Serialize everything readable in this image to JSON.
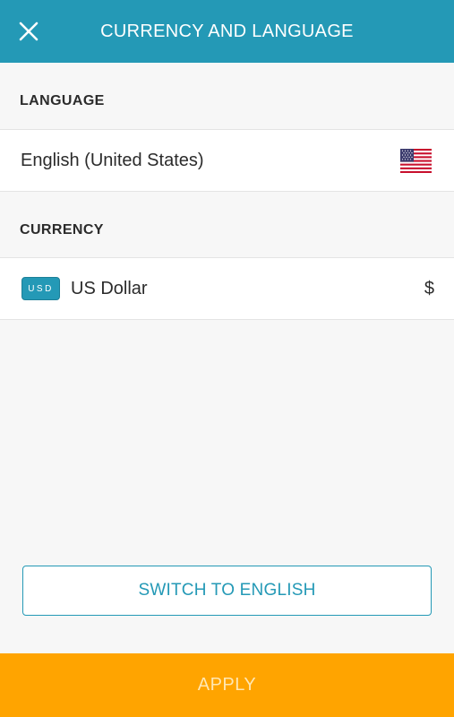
{
  "header": {
    "title": "CURRENCY AND LANGUAGE",
    "close_icon": "close-icon"
  },
  "language": {
    "section_label": "LANGUAGE",
    "selected": "English (United States)",
    "flag_icon": "us-flag-icon"
  },
  "currency": {
    "section_label": "CURRENCY",
    "code": "USD",
    "name": "US Dollar",
    "symbol": "$"
  },
  "actions": {
    "switch_label": "SWITCH TO ENGLISH",
    "apply_label": "APPLY"
  },
  "colors": {
    "header_bg": "#2499b6",
    "accent": "#2499b6",
    "apply_bg": "#ffa400",
    "apply_text": "#ffe7b3",
    "page_bg": "#f7f7f7"
  }
}
